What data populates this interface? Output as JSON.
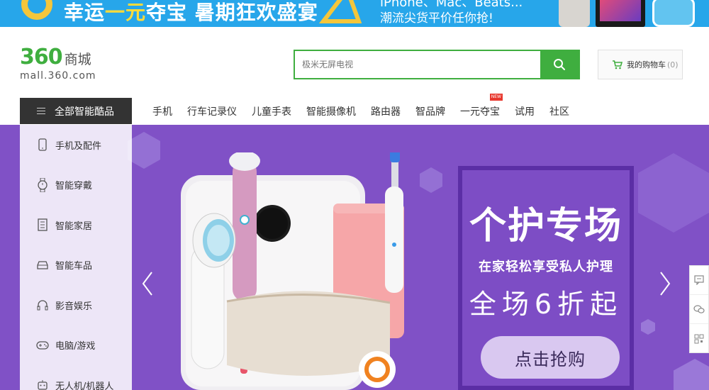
{
  "banner": {
    "headline_prefix": "幸运",
    "headline_highlight": "一元",
    "headline_suffix": "夺宝",
    "headline_event": "暑期狂欢盛宴",
    "subtitle_line1": "iPhone、Mac、Beats...",
    "subtitle_line2": "潮流尖货平价任你抢!",
    "colors": {
      "background": "#27a6ea",
      "highlight": "#ffdb3a"
    }
  },
  "header": {
    "logo_number": "360",
    "logo_text": "商城",
    "logo_url": "mall.360.com",
    "search_placeholder": "极米无屏电视",
    "search_icon": "search-icon",
    "cart_label": "我的购物车",
    "cart_count": "(0)",
    "colors": {
      "brand": "#3fae3f"
    }
  },
  "nav": {
    "all_categories_label": "全部智能酷品",
    "links": [
      {
        "label": "手机"
      },
      {
        "label": "行车记录仪"
      },
      {
        "label": "儿童手表"
      },
      {
        "label": "智能摄像机"
      },
      {
        "label": "路由器"
      },
      {
        "label": "智品牌"
      },
      {
        "label": "一元夺宝",
        "badge": "NEW"
      },
      {
        "label": "试用"
      },
      {
        "label": "社区"
      }
    ]
  },
  "sidebar": {
    "items": [
      {
        "label": "手机及配件",
        "icon": "phone-icon"
      },
      {
        "label": "智能穿戴",
        "icon": "watch-icon"
      },
      {
        "label": "智能家居",
        "icon": "home-icon"
      },
      {
        "label": "智能车品",
        "icon": "car-icon"
      },
      {
        "label": "影音娱乐",
        "icon": "headphones-icon"
      },
      {
        "label": "电脑/游戏",
        "icon": "gamepad-icon"
      },
      {
        "label": "无人机/机器人",
        "icon": "robot-icon"
      }
    ]
  },
  "hero": {
    "title": "个护专场",
    "subtitle": "在家轻松享受私人护理",
    "discount": "全场6折起",
    "cta_label": "点击抢购",
    "colors": {
      "background": "#8051c6",
      "panel_border": "#5b2ea5"
    }
  },
  "side_tools": [
    "feedback-icon",
    "chat-icon",
    "qr-code-icon"
  ]
}
